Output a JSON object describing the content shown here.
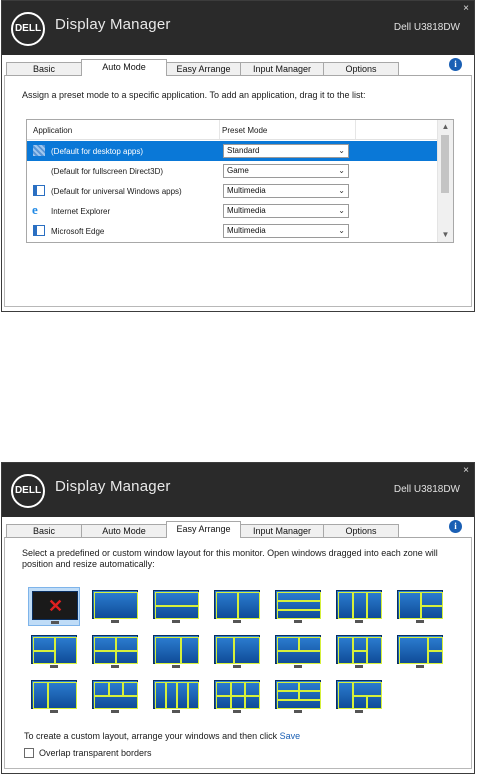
{
  "windows": [
    {
      "title": "Display Manager",
      "logo": "DELL",
      "model": "Dell U3818DW",
      "close": "×",
      "info": "i",
      "tabs": [
        {
          "label": "Basic"
        },
        {
          "label": "Auto Mode"
        },
        {
          "label": "Easy Arrange"
        },
        {
          "label": "Input Manager"
        },
        {
          "label": "Options"
        }
      ],
      "active_tab": "Auto Mode",
      "instruction": "Assign a preset mode to a specific application.  To add an application, drag it to the list:",
      "list": {
        "col_application": "Application",
        "col_preset": "Preset Mode",
        "rows": [
          {
            "name": "(Default for desktop apps)",
            "mode": "Standard",
            "icon": "desktop-apps-icon",
            "selected": true
          },
          {
            "name": "(Default for fullscreen Direct3D)",
            "mode": "Game",
            "icon": "blank-icon",
            "selected": false
          },
          {
            "name": "(Default for universal Windows apps)",
            "mode": "Multimedia",
            "icon": "window-app-icon",
            "selected": false
          },
          {
            "name": "Internet Explorer",
            "mode": "Multimedia",
            "icon": "internet-explorer-icon",
            "selected": false
          },
          {
            "name": "Microsoft Edge",
            "mode": "Multimedia",
            "icon": "window-app-icon",
            "selected": false
          }
        ],
        "scroll_up": "▲",
        "scroll_down": "▼",
        "dropdown_arrow": "⌄"
      }
    },
    {
      "title": "Display Manager",
      "logo": "DELL",
      "model": "Dell U3818DW",
      "close": "×",
      "info": "i",
      "tabs": [
        {
          "label": "Basic"
        },
        {
          "label": "Auto Mode"
        },
        {
          "label": "Easy Arrange"
        },
        {
          "label": "Input Manager"
        },
        {
          "label": "Options"
        }
      ],
      "active_tab": "Easy Arrange",
      "instruction": "Select a predefined or custom window layout for this monitor.  Open windows dragged into each zone will position and resize automatically:",
      "layouts_count": 20,
      "selected_layout_mark": "✕",
      "custom_text": "To create a custom layout, arrange your windows and then click",
      "save_link": "Save",
      "overlap_label": "Overlap transparent borders",
      "overlap_checked": false
    }
  ],
  "colors": {
    "titlebar": "#2a2a2a",
    "selection": "#0a78d7",
    "zone_border": "#d6f03a",
    "monitor": "#1a5fb4",
    "link": "#1a5fb4"
  }
}
